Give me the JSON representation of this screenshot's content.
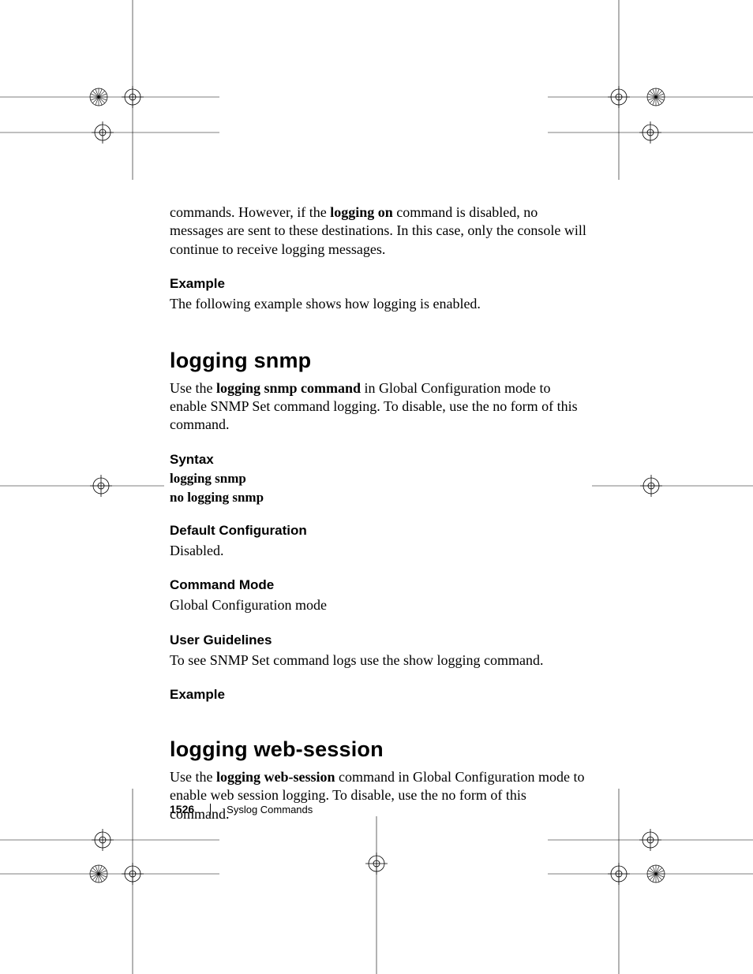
{
  "paragraphs": {
    "intro_1a": "commands. However, if the ",
    "intro_1_bold": "logging on",
    "intro_1b": " command is disabled, no messages are sent to these destinations. In this case, only the console will continue to receive logging messages.",
    "example_heading_1": "Example",
    "example_text_1": "The following example shows how logging is enabled.",
    "title_snmp": "logging snmp",
    "snmp_intro_a": "Use the ",
    "snmp_intro_bold": "logging snmp command",
    "snmp_intro_b": " in Global Configuration mode to enable SNMP Set command logging. To disable, use the no form of this command.",
    "syntax_heading": "Syntax",
    "syntax_line_1": "logging snmp",
    "syntax_line_2": "no logging snmp",
    "default_heading": "Default Configuration",
    "default_text": "Disabled.",
    "mode_heading": "Command Mode",
    "mode_text": "Global Configuration mode",
    "guidelines_heading": "User Guidelines",
    "guidelines_text": "To see SNMP Set command logs use the show logging command.",
    "example_heading_2": "Example",
    "title_web": "logging web-session",
    "web_intro_a": "Use the ",
    "web_intro_bold": "logging web-session",
    "web_intro_b": " command in Global Configuration mode to enable web session logging. To disable, use the no form of this command."
  },
  "footer": {
    "page_number": "1526",
    "section": "Syslog Commands"
  }
}
